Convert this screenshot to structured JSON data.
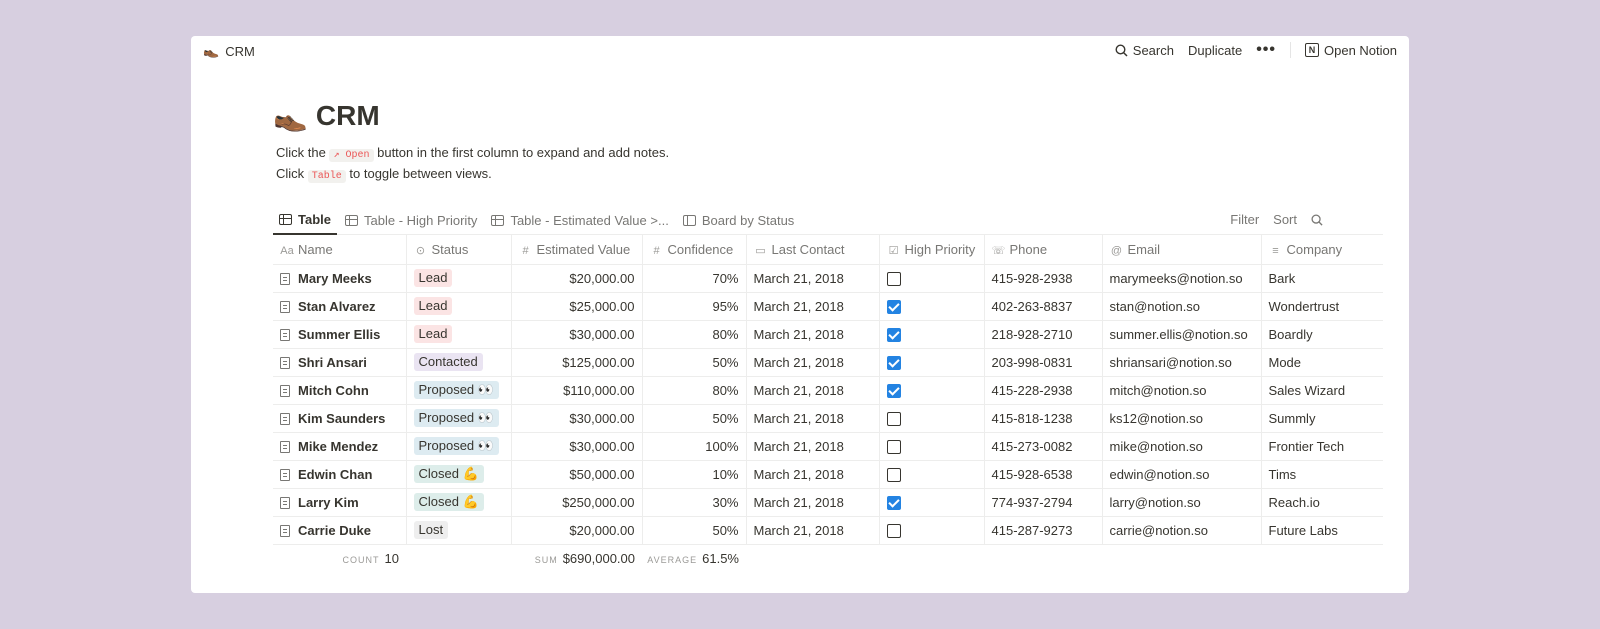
{
  "topbar": {
    "crumb_emoji": "👞",
    "crumb_title": "CRM",
    "search_label": "Search",
    "duplicate_label": "Duplicate",
    "more_label": "•••",
    "open_notion_label": "Open Notion"
  },
  "page": {
    "emoji": "👞",
    "title": "CRM",
    "desc1_pre": "Click the ",
    "desc1_code": "↗ Open",
    "desc1_post": " button in the first column to expand and add notes.",
    "desc2_pre": "Click ",
    "desc2_code": "Table",
    "desc2_post": " to toggle between views."
  },
  "tabs": [
    "Table",
    "Table - High Priority",
    "Table - Estimated Value >...",
    "Board by Status"
  ],
  "view_actions": {
    "filter": "Filter",
    "sort": "Sort"
  },
  "columns": [
    "Name",
    "Status",
    "Estimated Value",
    "Confidence",
    "Last Contact",
    "High Priority",
    "Phone",
    "Email",
    "Company"
  ],
  "column_icons": [
    "Aa",
    "⊙",
    "#",
    "#",
    "▭",
    "☑",
    "☏",
    "@",
    "≡"
  ],
  "status_colors": {
    "Lead": "#fbe4e4",
    "Contacted": "#eae4f2",
    "Proposed 👀": "#ddebf1",
    "Closed 💪": "#ddedea",
    "Lost": "#eeeeee"
  },
  "rows": [
    {
      "name": "Mary Meeks",
      "status": "Lead",
      "value": "$20,000.00",
      "confidence": "70%",
      "last_contact": "March 21, 2018",
      "high_priority": false,
      "phone": "415-928-2938",
      "email": "marymeeks@notion.so",
      "company": "Bark"
    },
    {
      "name": "Stan Alvarez",
      "status": "Lead",
      "value": "$25,000.00",
      "confidence": "95%",
      "last_contact": "March 21, 2018",
      "high_priority": true,
      "phone": "402-263-8837",
      "email": "stan@notion.so",
      "company": "Wondertrust"
    },
    {
      "name": "Summer Ellis",
      "status": "Lead",
      "value": "$30,000.00",
      "confidence": "80%",
      "last_contact": "March 21, 2018",
      "high_priority": true,
      "phone": "218-928-2710",
      "email": "summer.ellis@notion.so",
      "company": "Boardly"
    },
    {
      "name": "Shri Ansari",
      "status": "Contacted",
      "value": "$125,000.00",
      "confidence": "50%",
      "last_contact": "March 21, 2018",
      "high_priority": true,
      "phone": "203-998-0831",
      "email": "shriansari@notion.so",
      "company": "Mode"
    },
    {
      "name": "Mitch Cohn",
      "status": "Proposed 👀",
      "value": "$110,000.00",
      "confidence": "80%",
      "last_contact": "March 21, 2018",
      "high_priority": true,
      "phone": "415-228-2938",
      "email": "mitch@notion.so",
      "company": "Sales Wizard"
    },
    {
      "name": "Kim Saunders",
      "status": "Proposed 👀",
      "value": "$30,000.00",
      "confidence": "50%",
      "last_contact": "March 21, 2018",
      "high_priority": false,
      "phone": "415-818-1238",
      "email": "ks12@notion.so",
      "company": "Summly"
    },
    {
      "name": "Mike Mendez",
      "status": "Proposed 👀",
      "value": "$30,000.00",
      "confidence": "100%",
      "last_contact": "March 21, 2018",
      "high_priority": false,
      "phone": "415-273-0082",
      "email": "mike@notion.so",
      "company": "Frontier Tech"
    },
    {
      "name": "Edwin Chan",
      "status": "Closed 💪",
      "value": "$50,000.00",
      "confidence": "10%",
      "last_contact": "March 21, 2018",
      "high_priority": false,
      "phone": "415-928-6538",
      "email": "edwin@notion.so",
      "company": "Tims"
    },
    {
      "name": "Larry Kim",
      "status": "Closed 💪",
      "value": "$250,000.00",
      "confidence": "30%",
      "last_contact": "March 21, 2018",
      "high_priority": true,
      "phone": "774-937-2794",
      "email": "larry@notion.so",
      "company": "Reach.io"
    },
    {
      "name": "Carrie Duke",
      "status": "Lost",
      "value": "$20,000.00",
      "confidence": "50%",
      "last_contact": "March 21, 2018",
      "high_priority": false,
      "phone": "415-287-9273",
      "email": "carrie@notion.so",
      "company": "Future Labs"
    }
  ],
  "footer": {
    "count_label": "COUNT",
    "count_value": "10",
    "sum_label": "SUM",
    "sum_value": "$690,000.00",
    "avg_label": "AVERAGE",
    "avg_value": "61.5%"
  }
}
